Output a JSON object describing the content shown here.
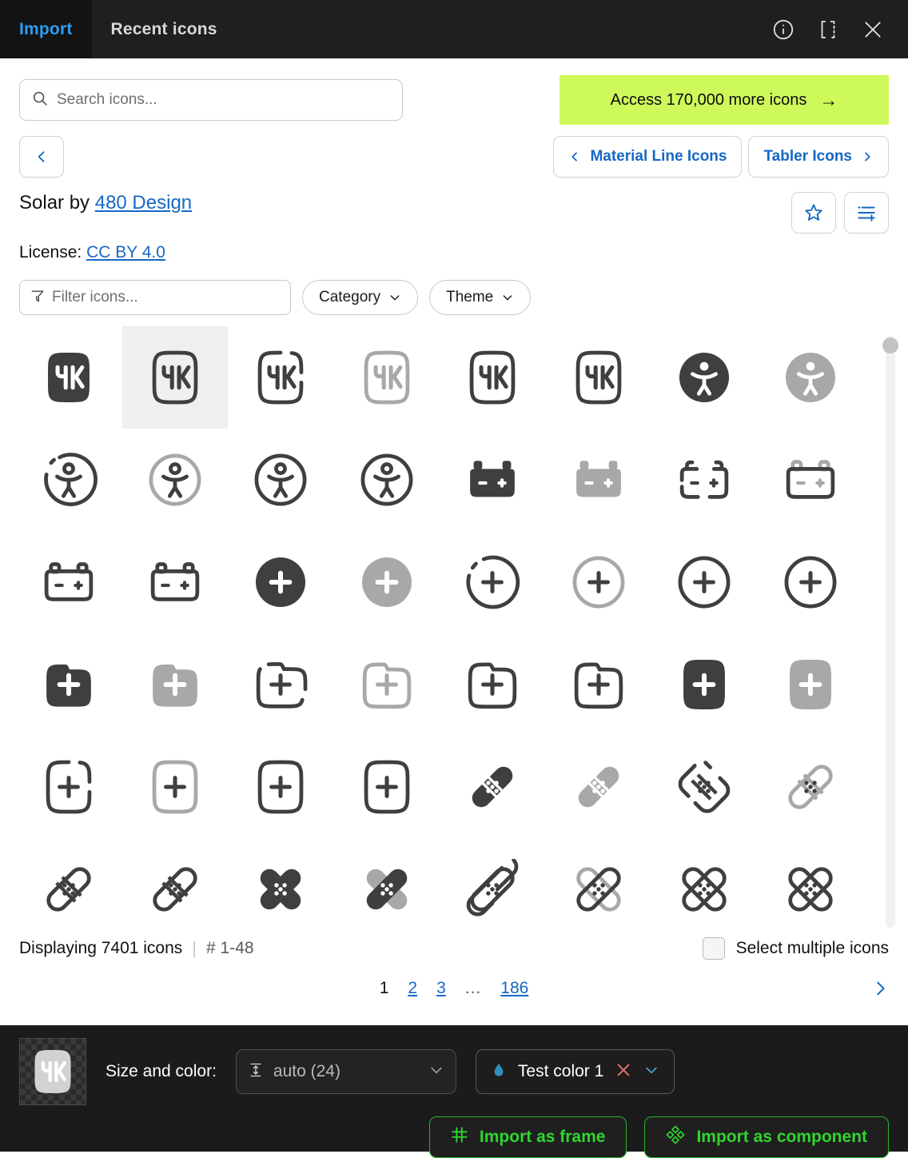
{
  "topbar": {
    "tab_import": "Import",
    "tab_recent": "Recent icons",
    "icons": [
      "info-icon",
      "component-icon",
      "close-icon"
    ]
  },
  "search": {
    "placeholder": "Search icons...",
    "value": ""
  },
  "cta": {
    "label": "Access 170,000 more icons",
    "arrow": "→",
    "bg_color": "#cdf95a"
  },
  "nav": {
    "back_label": "‹",
    "prev_pack": "Material Line Icons",
    "next_pack": "Tabler Icons"
  },
  "pack": {
    "title_prefix": "Solar by ",
    "author": "480 Design",
    "license_label": "License:",
    "license": "CC BY 4.0",
    "favorite_icon": "star-icon",
    "addlist_icon": "add-to-list-icon"
  },
  "filters": {
    "filter_placeholder": "Filter icons...",
    "filter_value": "",
    "category_label": "Category",
    "theme_label": "Theme"
  },
  "grid": {
    "selected_index": 1,
    "icons": [
      {
        "name": "4k-bold",
        "type": "4k",
        "style": "solid",
        "tone": "dark"
      },
      {
        "name": "4k-bold-duotone",
        "type": "4k",
        "style": "duotone",
        "tone": "green"
      },
      {
        "name": "4k-broken",
        "type": "4k",
        "style": "broken",
        "tone": "dark"
      },
      {
        "name": "4k-line-duotone",
        "type": "4k",
        "style": "outline",
        "tone": "gray"
      },
      {
        "name": "4k-linear",
        "type": "4k",
        "style": "outline",
        "tone": "dark"
      },
      {
        "name": "4k-outline",
        "type": "4k",
        "style": "outline",
        "tone": "dark"
      },
      {
        "name": "accessibility-bold",
        "type": "accessibility",
        "style": "solid",
        "tone": "dark"
      },
      {
        "name": "accessibility-bold-duotone",
        "type": "accessibility",
        "style": "solid",
        "tone": "gray"
      },
      {
        "name": "accessibility-broken",
        "type": "accessibility",
        "style": "broken",
        "tone": "dark"
      },
      {
        "name": "accessibility-line-duotone",
        "type": "accessibility",
        "style": "outline",
        "tone": "gray"
      },
      {
        "name": "accessibility-linear",
        "type": "accessibility",
        "style": "outline",
        "tone": "dark"
      },
      {
        "name": "accessibility-outline",
        "type": "accessibility",
        "style": "outline",
        "tone": "dark"
      },
      {
        "name": "accumulator-bold",
        "type": "battery",
        "style": "solid",
        "tone": "dark"
      },
      {
        "name": "accumulator-bold-duotone",
        "type": "battery",
        "style": "solid",
        "tone": "gray"
      },
      {
        "name": "accumulator-broken",
        "type": "battery",
        "style": "broken",
        "tone": "dark"
      },
      {
        "name": "accumulator-line-duotone",
        "type": "battery",
        "style": "outline",
        "tone": "gray"
      },
      {
        "name": "accumulator-linear",
        "type": "battery",
        "style": "outline",
        "tone": "dark"
      },
      {
        "name": "accumulator-outline",
        "type": "battery",
        "style": "outline",
        "tone": "dark"
      },
      {
        "name": "add-circle-bold",
        "type": "add-circle",
        "style": "solid",
        "tone": "dark"
      },
      {
        "name": "add-circle-bold-duotone",
        "type": "add-circle",
        "style": "solid",
        "tone": "gray"
      },
      {
        "name": "add-circle-broken",
        "type": "add-circle",
        "style": "broken",
        "tone": "dark"
      },
      {
        "name": "add-circle-line-duotone",
        "type": "add-circle",
        "style": "outline",
        "tone": "gray"
      },
      {
        "name": "add-circle-linear",
        "type": "add-circle",
        "style": "outline",
        "tone": "dark"
      },
      {
        "name": "add-circle-outline",
        "type": "add-circle",
        "style": "outline",
        "tone": "dark"
      },
      {
        "name": "add-folder-bold",
        "type": "add-folder",
        "style": "solid",
        "tone": "dark"
      },
      {
        "name": "add-folder-bold-duotone",
        "type": "add-folder",
        "style": "solid",
        "tone": "gray"
      },
      {
        "name": "add-folder-broken",
        "type": "add-folder",
        "style": "broken",
        "tone": "dark"
      },
      {
        "name": "add-folder-line-duotone",
        "type": "add-folder",
        "style": "outline",
        "tone": "gray"
      },
      {
        "name": "add-folder-linear",
        "type": "add-folder",
        "style": "outline",
        "tone": "dark"
      },
      {
        "name": "add-folder-outline",
        "type": "add-folder",
        "style": "outline",
        "tone": "dark"
      },
      {
        "name": "add-square-bold",
        "type": "add-square",
        "style": "solid",
        "tone": "dark"
      },
      {
        "name": "add-square-bold-duotone",
        "type": "add-square",
        "style": "solid",
        "tone": "gray"
      },
      {
        "name": "add-square-broken",
        "type": "add-square",
        "style": "broken",
        "tone": "dark"
      },
      {
        "name": "add-square-line-duotone",
        "type": "add-square",
        "style": "outline",
        "tone": "gray"
      },
      {
        "name": "add-square-linear",
        "type": "add-square",
        "style": "outline",
        "tone": "dark"
      },
      {
        "name": "add-square-outline",
        "type": "add-square",
        "style": "outline",
        "tone": "dark"
      },
      {
        "name": "plaster-bold",
        "type": "plaster",
        "style": "solid",
        "tone": "dark"
      },
      {
        "name": "plaster-bold-duotone",
        "type": "plaster",
        "style": "solid",
        "tone": "gray"
      },
      {
        "name": "plaster-broken",
        "type": "plaster",
        "style": "broken",
        "tone": "dark"
      },
      {
        "name": "plaster-line-duotone",
        "type": "plaster",
        "style": "outline",
        "tone": "gray"
      },
      {
        "name": "plaster-linear",
        "type": "plaster",
        "style": "outline",
        "tone": "dark"
      },
      {
        "name": "plaster-outline",
        "type": "plaster",
        "style": "outline",
        "tone": "dark"
      },
      {
        "name": "plaster-circle-bold",
        "type": "plaster-cross",
        "style": "solid",
        "tone": "dark"
      },
      {
        "name": "plaster-circle-bold-duotone",
        "type": "plaster-cross",
        "style": "solid",
        "tone": "gray"
      },
      {
        "name": "plaster-circle-broken",
        "type": "plaster-cross",
        "style": "broken",
        "tone": "dark"
      },
      {
        "name": "plaster-circle-line-duotone",
        "type": "plaster-cross",
        "style": "outline",
        "tone": "gray"
      },
      {
        "name": "plaster-circle-linear",
        "type": "plaster-cross",
        "style": "outline",
        "tone": "dark"
      },
      {
        "name": "plaster-circle-outline",
        "type": "plaster-cross",
        "style": "outline",
        "tone": "dark"
      }
    ]
  },
  "status": {
    "displaying": "Displaying 7401 icons",
    "separator": "|",
    "range": "# 1-48",
    "select_multiple": "Select multiple icons",
    "checkbox_checked": false
  },
  "pagination": {
    "current": "1",
    "pages": [
      "2",
      "3"
    ],
    "dots": "...",
    "last": "186",
    "next_icon": "chevron-right-icon"
  },
  "bottombar": {
    "preview_icon": "4k-bold-duotone",
    "size_label": "Size and color:",
    "size_value": "auto (24)",
    "color_name": "Test color 1",
    "color_swatch": "#2e8fc0",
    "clear_color_icon": "close-icon",
    "import_frame": "Import as frame",
    "import_component": "Import as component"
  }
}
